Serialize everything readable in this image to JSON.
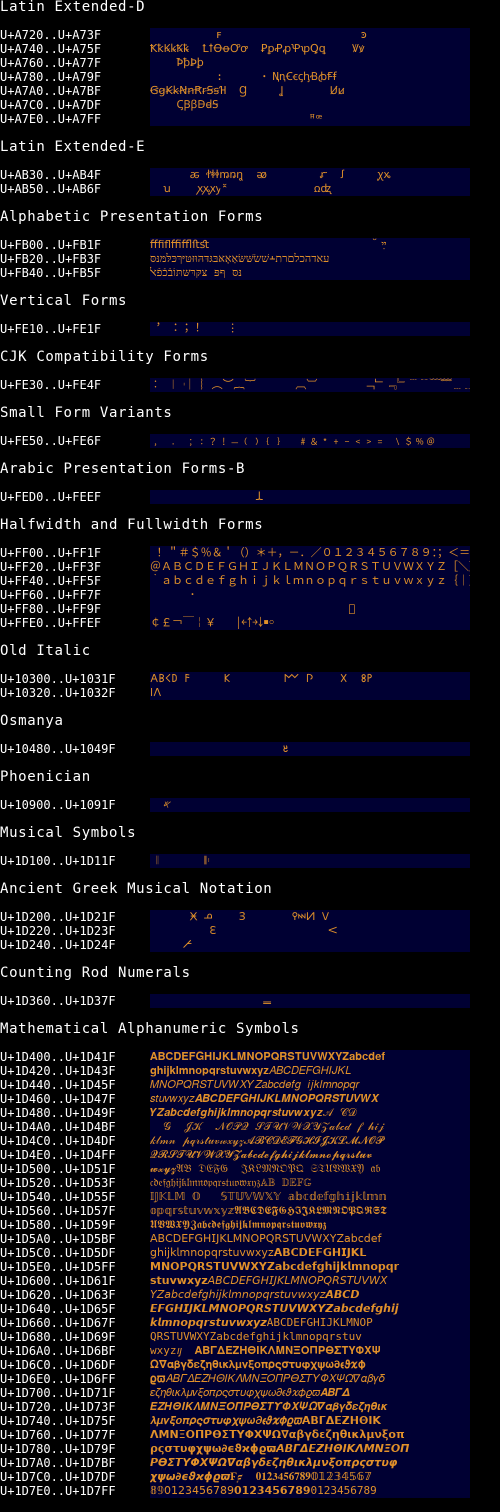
{
  "colors": {
    "background": "#000000",
    "title_text": "#ffffff",
    "label_text": "#ffffff",
    "cell_background": "#000033",
    "glyph_color": "#e0902a"
  },
  "sections": [
    {
      "title": "Latin Extended-D",
      "rows": [
        {
          "label": "U+A720..U+A73F",
          "glyphs": "          ꜰ                     ꜿ"
        },
        {
          "label": "U+A740..U+A75F",
          "glyphs": "ꝀꝁꝂꝃꝄꝅ  ꝈꝉꝊꝋꝌꝍ  ꝐꝑꝒꝓꝔꝕꝖꝗ    Ꝟꝟ"
        },
        {
          "label": "U+A760..U+A77F",
          "glyphs": "    ꝤꝥꝦꝧ"
        },
        {
          "label": "U+A780..U+A79F",
          "glyphs": "          ꞉      ꞏ ꞐꞑꞒꞓꞔꞕꞖꞗꞘꞙ"
        },
        {
          "label": "U+A7A0..U+A7BF",
          "glyphs": "ꞠꞡꞢꞣꞤꞥꞦꞧꞨꞩꞪ  Ɡ     Ʝ       Ꞹꞹ"
        },
        {
          "label": "U+A7C0..U+A7DF",
          "glyphs": "    ꟄꞴꞵꟇꟈꟉ"
        },
        {
          "label": "U+A7E0..U+A7FF",
          "glyphs": "                        ꟸꟹ"
        }
      ]
    },
    {
      "title": "Latin Extended-E",
      "rows": [
        {
          "label": "U+AB30..U+AB4F",
          "glyphs": "      ꬱ ꬷꬸꬹꬺꬻꬼ  ꭁ        ꭊ  ꭍ     ꭕꭖ"
        },
        {
          "label": "U+AB50..U+AB6F",
          "glyphs": "  ꭒ    ꭗꭘꭙꭚ꭛             ꭥꭦ"
        }
      ]
    },
    {
      "title": "Alphabetic Presentation Forms",
      "rows": [
        {
          "label": "U+FB00..U+FB1F",
          "glyphs": "ﬀﬁﬂﬃﬄﬅﬆ                         ﬞ ײַ"
        },
        {
          "label": "U+FB20..U+FB3F",
          "glyphs": "ﬠﬡﬢﬣﬤﬥﬦﬧﬨ﬩שׁשׂשּׁשּׂאַאָאּבּגּדּהּוּזּטּיּךּכּלּמּנּסּ"
        },
        {
          "label": "U+FB40..U+FB5F",
          "glyphs": "נּסּ ףּפּ צּקּרּשּתּוֹבֿכֿפֿﭏ"
        }
      ]
    },
    {
      "title": "Vertical Forms",
      "rows": [
        {
          "label": "U+FE10..U+FE1F",
          "glyphs": "︐ ︓︔︕    ︙"
        }
      ]
    },
    {
      "title": "CJK Compatibility Forms",
      "rows": [
        {
          "label": "U+FE30..U+FE4F",
          "glyphs": "︰ ︱︲︳︴︵︶︷︸      ︹︺       ﹁﹂﹃﹄﹉﹊﹋﹌﹍﹎﹏"
        }
      ]
    },
    {
      "title": "Small Form Variants",
      "rows": [
        {
          "label": "U+FE50..U+FE6F",
          "glyphs": "﹐ ﹒ ﹔﹕﹖﹗﹘﹙﹚﹛﹜  ﹟﹠﹡﹢﹣﹤﹥﹦ ﹨﹩﹪﹫"
        }
      ]
    },
    {
      "title": "Arabic Presentation Forms-B",
      "rows": [
        {
          "label": "U+FED0..U+FEEF",
          "glyphs": "                ﻠ"
        }
      ]
    },
    {
      "title": "Halfwidth and Fullwidth Forms",
      "rows": [
        {
          "label": "U+FF00..U+FF1F",
          "glyphs": " ！＂＃＄％＆＇（）＊＋，－．／０１２３４５６７８９：；＜＝＞？"
        },
        {
          "label": "U+FF20..U+FF3F",
          "glyphs": "＠ＡＢＣＤＥＦＧＨＩＪＫＬＭＮＯＰＱＲＳＴＵＶＷＸＹＺ［＼］＾＿"
        },
        {
          "label": "U+FF40..U+FF5F",
          "glyphs": "｀ａｂｃｄｅｆｇｈｉｊｋｌｍｎｏｐｑｒｓｔｕｖｗｘｙｚ｛｜｝～｟"
        },
        {
          "label": "U+FF60..U+FF7F",
          "glyphs": "      ･"
        },
        {
          "label": "U+FF80..U+FF9F",
          "glyphs": "                              ﾞ"
        },
        {
          "label": "U+FFE0..U+FFEF",
          "glyphs": "￠￡￢￣￤￥   ￨￩￪￫￬￭￮"
        }
      ]
    },
    {
      "title": "Old Italic",
      "rows": [
        {
          "label": "U+10300..U+1031F",
          "glyphs": "𐌀𐌁𐌂𐌃 𐌅     𐌊        𐌌 𐌐    𐌗  𐌚𐌛"
        },
        {
          "label": "U+10320..U+1032F",
          "glyphs": "𐌠𐌡"
        }
      ]
    },
    {
      "title": "Osmanya",
      "rows": [
        {
          "label": "U+10480..U+1049F",
          "glyphs": "                    𐒔"
        }
      ]
    },
    {
      "title": "Phoenician",
      "rows": [
        {
          "label": "U+10900..U+1091F",
          "glyphs": "  𐤀"
        }
      ]
    },
    {
      "title": "Musical Symbols",
      "rows": [
        {
          "label": "U+1D100..U+1D11F",
          "glyphs": " 𝄁       𝄆"
        }
      ]
    },
    {
      "title": "Ancient Greek Musical Notation",
      "rows": [
        {
          "label": "U+1D200..U+1D21F",
          "glyphs": "      𝈂 𝈃    𝈆       𝈉𝈊𝈋 𝈍"
        },
        {
          "label": "U+1D220..U+1D23F",
          "glyphs": "         𝈡                 𝈶"
        },
        {
          "label": "U+1D240..U+1D24F",
          "glyphs": "     𝉀"
        }
      ]
    },
    {
      "title": "Counting Rod Numerals",
      "rows": [
        {
          "label": "U+1D360..U+1D37F",
          "glyphs": "                 𝍡"
        }
      ]
    },
    {
      "title": "Mathematical Alphanumeric Symbols",
      "rows": [
        {
          "label": "U+1D400..U+1D41F",
          "glyphs": "𝐀𝐁𝐂𝐃𝐄𝐅𝐆𝐇𝐈𝐉𝐊𝐋𝐌𝐍𝐎𝐏𝐐𝐑𝐒𝐓𝐔𝐕𝐖𝐗𝐘𝐙𝐚𝐛𝐜𝐝𝐞𝐟"
        },
        {
          "label": "U+1D420..U+1D43F",
          "glyphs": "𝐠𝐡𝐢𝐣𝐤𝐥𝐦𝐧𝐨𝐩𝐪𝐫𝐬𝐭𝐮𝐯𝐰𝐱𝐲𝐳𝐴𝐵𝐶𝐷𝐸𝐹𝐺𝐻𝐼𝐽𝐾𝐿"
        },
        {
          "label": "U+1D440..U+1D45F",
          "glyphs": "𝑀𝑁𝑂𝑃𝑄𝑅𝑆𝑇𝑈𝑉𝑊𝑋𝑌𝑍𝑎𝑏𝑐𝑑𝑒𝑓𝑔 𝑖𝑗𝑘𝑙𝑚𝑛𝑜𝑝𝑞𝑟"
        },
        {
          "label": "U+1D460..U+1D47F",
          "glyphs": "𝑠𝑡𝑢𝑣𝑤𝑥𝑦𝑧𝑨𝑩𝑪𝑫𝑬𝑭𝑮𝑯𝑰𝑱𝑲𝑳𝑴𝑵𝑶𝑷𝑸𝑹𝑺𝑻𝑼𝑽𝑾𝑿"
        },
        {
          "label": "U+1D480..U+1D49F",
          "glyphs": "𝒀𝒁𝒂𝒃𝒄𝒅𝒆𝒇𝒈𝒉𝒊𝒋𝒌𝒍𝒎𝒏𝒐𝒑𝒒𝒓𝒔𝒕𝒖𝒗𝒘𝒙𝒚𝒛𝒜 𝒞𝒟"
        },
        {
          "label": "U+1D4A0..U+1D4BF",
          "glyphs": "  𝒢  𝒥𝒦  𝒩𝒪𝒫𝒬 𝒮𝒯𝒰𝒱𝒲𝒳𝒴𝒵𝒶𝒷𝒸𝒹 𝒻 𝒽𝒾𝒿"
        },
        {
          "label": "U+1D4C0..U+1D4DF",
          "glyphs": "𝓀𝓁𝓂𝓃 𝓅𝓆𝓇𝓈𝓉𝓊𝓋𝓌𝓍𝓎𝓏𝓐𝓑𝓒𝓓𝓔𝓕𝓖𝓗𝓘𝓙𝓚𝓛𝓜𝓝𝓞𝓟"
        },
        {
          "label": "U+1D4E0..U+1D4FF",
          "glyphs": "𝓠𝓡𝓢𝓣𝓤𝓥𝓦𝓧𝓨𝓩𝓪𝓫𝓬𝓭𝓮𝓯𝓰𝓱𝓲𝓳𝓴𝓵𝓶𝓷𝓸𝓹𝓺𝓻𝓼𝓽𝓾𝓿"
        },
        {
          "label": "U+1D500..U+1D51F",
          "glyphs": "𝔀𝔁𝔂𝔃𝔄𝔅 𝔇𝔈𝔉𝔊  𝔍𝔎𝔏𝔐𝔑𝔒𝔓𝔔 𝔖𝔗𝔘𝔙𝔚𝔛𝔜 𝔞𝔟"
        },
        {
          "label": "U+1D520..U+1D53F",
          "glyphs": "𝔠𝔡𝔢𝔣𝔤𝔥𝔦𝔧𝔨𝔩𝔪𝔫𝔬𝔭𝔮𝔯𝔰𝔱𝔲𝔳𝔴𝔵𝔶𝔷𝔸𝔹 𝔻𝔼𝔽𝔾"
        },
        {
          "label": "U+1D540..U+1D55F",
          "glyphs": "𝕀𝕁𝕂𝕃𝕄 𝕆   𝕊𝕋𝕌𝕍𝕎𝕏𝕐 𝕒𝕓𝕔𝕕𝕖𝕗𝕘𝕙𝕚𝕛𝕜𝕝𝕞𝕟"
        },
        {
          "label": "U+1D560..U+1D57F",
          "glyphs": "𝕠𝕡𝕢𝕣𝕤𝕥𝕦𝕧𝕨𝕩𝕪𝕫𝕬𝕭𝕮𝕯𝕰𝕱𝕲𝕳𝕴𝕵𝕶𝕷𝕸𝕹𝕺𝕻𝕼𝕽𝕾𝕿"
        },
        {
          "label": "U+1D580..U+1D59F",
          "glyphs": "𝖀𝖁𝖂𝖃𝖄𝖅𝖆𝖇𝖈𝖉𝖊𝖋𝖌𝖍𝖎𝖏𝖐𝖑𝖒𝖓𝖔𝖕𝖖𝖗𝖘𝖙𝖚𝖛𝖜𝖝𝖞𝖟"
        },
        {
          "label": "U+1D5A0..U+1D5BF",
          "glyphs": "𝖠𝖡𝖢𝖣𝖤𝖥𝖦𝖧𝖨𝖩𝖪𝖫𝖬𝖭𝖮𝖯𝖰𝖱𝖲𝖳𝖴𝖵𝖶𝖷𝖸𝖹𝖺𝖻𝖼𝖽𝖾𝖿"
        },
        {
          "label": "U+1D5C0..U+1D5DF",
          "glyphs": "𝗀𝗁𝗂𝗃𝗄𝗅𝗆𝗇𝗈𝗉𝗊𝗋𝗌𝗍𝗎𝗏𝗐𝗑𝗒𝗓𝗔𝗕𝗖𝗗𝗘𝗙𝗚𝗛𝗜𝗝𝗞𝗟"
        },
        {
          "label": "U+1D5E0..U+1D5FF",
          "glyphs": "𝗠𝗡𝗢𝗣𝗤𝗥𝗦𝗧𝗨𝗩𝗪𝗫𝗬𝗭𝗮𝗯𝗰𝗱𝗲𝗳𝗴𝗵𝗶𝗷𝗸𝗹𝗺𝗻𝗼𝗽𝗾𝗿"
        },
        {
          "label": "U+1D600..U+1D61F",
          "glyphs": "𝘀𝘁𝘂𝘃𝘄𝘅𝘆𝘇𝘈𝘉𝘊𝘋𝘌𝘍𝘎𝘏𝘐𝘑𝘒𝘓𝘔𝘕𝘖𝘗𝘘𝘙𝘚𝘛𝘜𝘝𝘞𝘟"
        },
        {
          "label": "U+1D620..U+1D63F",
          "glyphs": "𝘠𝘡𝘢𝘣𝘤𝘥𝘦𝘧𝘨𝘩𝘪𝘫𝘬𝘭𝘮𝘯𝘰𝘱𝘲𝘳𝘴𝘵𝘶𝘷𝘸𝘹𝘺𝘻𝘼𝘽𝘾𝘿"
        },
        {
          "label": "U+1D640..U+1D65F",
          "glyphs": "𝙀𝙁𝙂𝙃𝙄𝙅𝙆𝙇𝙈𝙉𝙊𝙋𝙌𝙍𝙎𝙏𝙐𝙑𝙒𝙓𝙔𝙕𝙖𝙗𝙘𝙙𝙚𝙛𝙜𝙝𝙞𝙟"
        },
        {
          "label": "U+1D660..U+1D67F",
          "glyphs": "𝙠𝙡𝙢𝙣𝙤𝙥𝙦𝙧𝙨𝙩𝙪𝙫𝙬𝙭𝙮𝙯𝙰𝙱𝙲𝙳𝙴𝙵𝙶𝙷𝙸𝙹𝙺𝙻𝙼𝙽𝙾𝙿"
        },
        {
          "label": "U+1D680..U+1D69F",
          "glyphs": "𝚀𝚁𝚂𝚃𝚄𝚅𝚆𝚇𝚈𝚉𝚊𝚋𝚌𝚍𝚎𝚏𝚐𝚑𝚒𝚓𝚔𝚕𝚖𝚗𝚘𝚙𝚚𝚛𝚜𝚝𝚞𝚟"
        },
        {
          "label": "U+1D6A0..U+1D6BF",
          "glyphs": "𝚠𝚡𝚢𝚣𝚤𝚥  𝚨𝚩𝚪𝚫𝚬𝚭𝚮𝚯𝚰𝚱𝚲𝚳𝚴𝚵𝚶𝚷𝚸𝚹𝚺𝚻𝚼𝚽𝚾𝚿"
        },
        {
          "label": "U+1D6C0..U+1D6DF",
          "glyphs": "𝛀𝛁𝛂𝛃𝛄𝛅𝛆𝛇𝛈𝛉𝛊𝛋𝛌𝛍𝛎𝛏𝛐𝛑𝛒𝛓𝛔𝛕𝛖𝛗𝛘𝛙𝛚𝛛𝛜𝛝𝛞𝛟"
        },
        {
          "label": "U+1D6E0..U+1D6FF",
          "glyphs": "𝛠𝛡𝛢𝛣𝛤𝛥𝛦𝛧𝛨𝛩𝛪𝛫𝛬𝛭𝛮𝛯𝛰𝛱𝛲𝛳𝛴𝛵𝛶𝛷𝛸𝛹𝛺𝛻𝛼𝛽𝛾𝛿"
        },
        {
          "label": "U+1D700..U+1D71F",
          "glyphs": "𝜀𝜁𝜂𝜃𝜄𝜅𝜆𝜇𝜈𝜉𝜊𝜋𝜌𝜍𝜎𝜏𝜐𝜑𝜒𝜓𝜔𝜕𝜖𝜗𝜘𝜙𝜚𝜛𝜜𝜝𝜞𝜟"
        },
        {
          "label": "U+1D720..U+1D73F",
          "glyphs": "𝜠𝜡𝜢𝜣𝜤𝜥𝜦𝜧𝜨𝜩𝜪𝜫𝜬𝜭𝜮𝜯𝜰𝜱𝜲𝜳𝜴𝜵𝜶𝜷𝜸𝜹𝜺𝜻𝜼𝜽𝜾𝜿"
        },
        {
          "label": "U+1D740..U+1D75F",
          "glyphs": "𝝀𝝁𝝂𝝃𝝄𝝅𝝆𝝇𝝈𝝉𝝊𝝋𝝌𝝍𝝎𝝏𝝐𝝑𝝒𝝓𝝔𝝕𝝖𝝗𝝘𝝙𝝚𝝛𝝜𝝝𝝞𝝟"
        },
        {
          "label": "U+1D760..U+1D77F",
          "glyphs": "𝝠𝝡𝝢𝝣𝝤𝝥𝝦𝝧𝝨𝝩𝝪𝝫𝝬𝝭𝝮𝝯𝝰𝝱𝝲𝝳𝝴𝝵𝝶𝝷𝝸𝝹𝝺𝝻𝝼𝝽𝝾𝝿"
        },
        {
          "label": "U+1D780..U+1D79F",
          "glyphs": "𝞀𝞁𝞂𝞃𝞄𝞅𝞆𝞇𝞈𝞉𝞊𝞋𝞌𝞍𝞎𝞏𝞐𝞑𝞒𝞓𝞔𝞕𝞖𝞗𝞘𝞙𝞚𝞛𝞜𝞝𝞞𝞟"
        },
        {
          "label": "U+1D7A0..U+1D7BF",
          "glyphs": "𝞠𝞡𝞢𝞣𝞤𝞥𝞦𝞧𝞨𝞩𝞪𝞫𝞬𝞭𝞮𝞯𝞰𝞱𝞲𝞳𝞴𝞵𝞶𝞷𝞸𝞹𝞺𝞻𝞼𝞽𝞾𝞿"
        },
        {
          "label": "U+1D7C0..U+1D7DF",
          "glyphs": "𝟀𝟁𝟂𝟃𝟄𝟅𝟆𝟇𝟈𝟉𝟊𝟋  𝟎𝟏𝟐𝟑𝟒𝟓𝟔𝟕𝟖𝟗𝟘𝟙𝟚𝟛𝟜𝟝𝟞𝟟"
        },
        {
          "label": "U+1D7E0..U+1D7FF",
          "glyphs": "𝟠𝟡𝟢𝟣𝟤𝟥𝟦𝟧𝟨𝟩𝟪𝟫𝟬𝟭𝟮𝟯𝟰𝟱𝟲𝟳𝟴𝟵𝟶𝟷𝟸𝟹𝟺𝟻𝟼𝟽𝟾𝟿"
        }
      ]
    }
  ]
}
